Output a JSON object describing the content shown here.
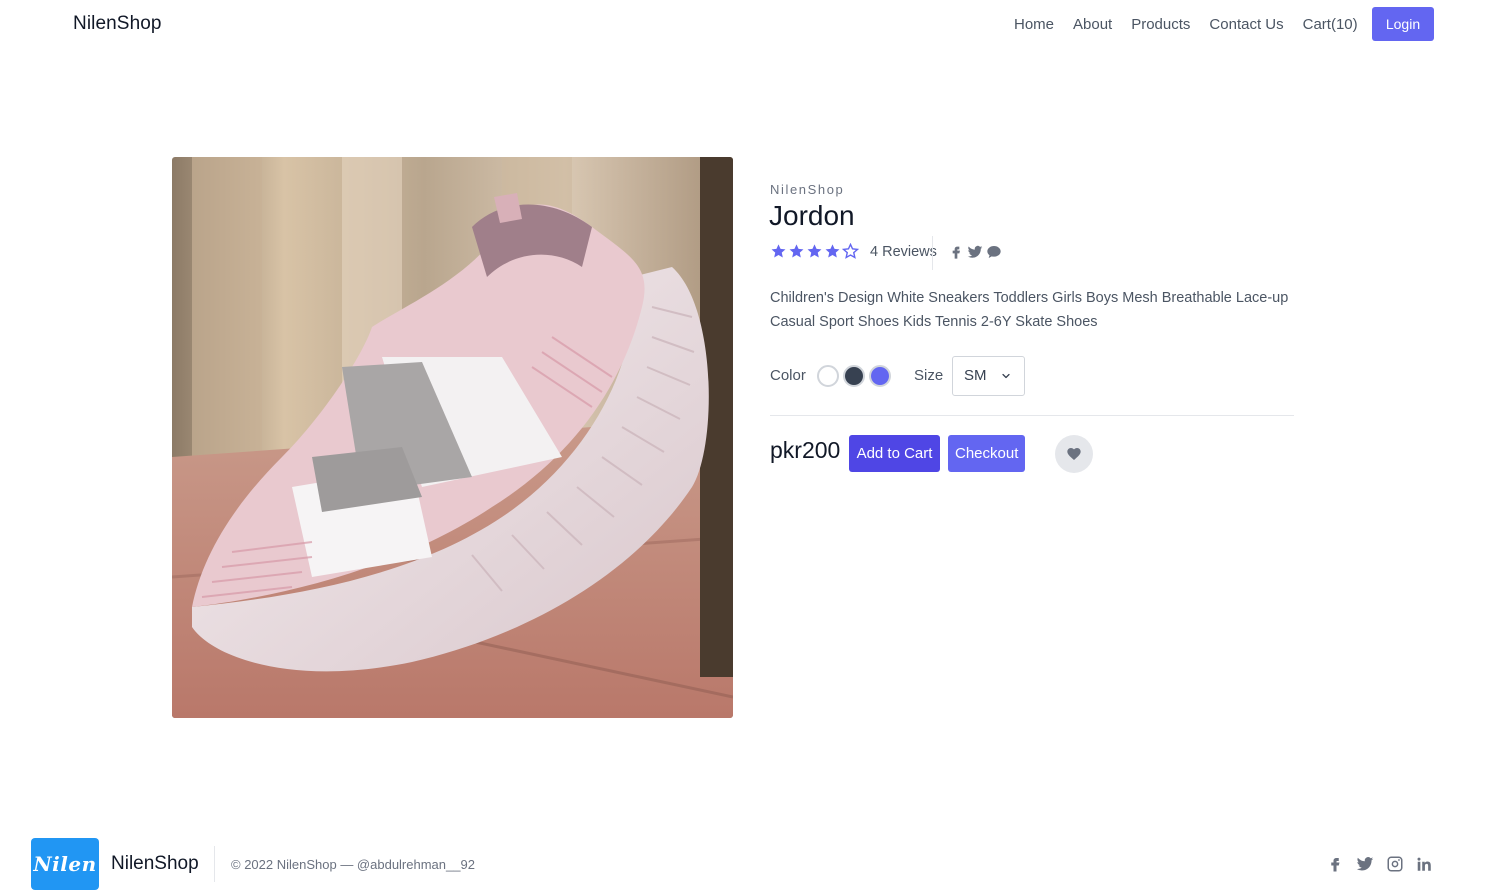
{
  "header": {
    "brand": "NilenShop",
    "nav": [
      "Home",
      "About",
      "Products",
      "Contact Us",
      "Cart(10)"
    ],
    "login_label": "Login"
  },
  "product": {
    "brand": "NilenShop",
    "title": "Jordon",
    "rating": 4,
    "rating_max": 5,
    "reviews": "4 Reviews",
    "description": "Children's Design White Sneakers Toddlers Girls Boys Mesh Breathable Lace-up Casual Sport Shoes Kids Tennis 2-6Y Skate Shoes",
    "color_label": "Color",
    "colors": [
      "#ffffff",
      "#374151",
      "#6366f1"
    ],
    "size_label": "Size",
    "size_value": "SM",
    "price": "pkr200",
    "add_to_cart_label": "Add to Cart",
    "checkout_label": "Checkout",
    "share_icons": [
      "facebook-icon",
      "twitter-icon",
      "chat-icon"
    ]
  },
  "footer": {
    "logo_text": "Nilen",
    "brand": "NilenShop",
    "copyright": "© 2022 NilenShop — @abdulrehman__92",
    "social_icons": [
      "facebook-icon",
      "twitter-icon",
      "instagram-icon",
      "linkedin-icon"
    ]
  },
  "colors": {
    "accent": "#6366f1",
    "accent_dark": "#4f46e5",
    "star": "#6366f1",
    "logo_bg": "#2196f3"
  }
}
